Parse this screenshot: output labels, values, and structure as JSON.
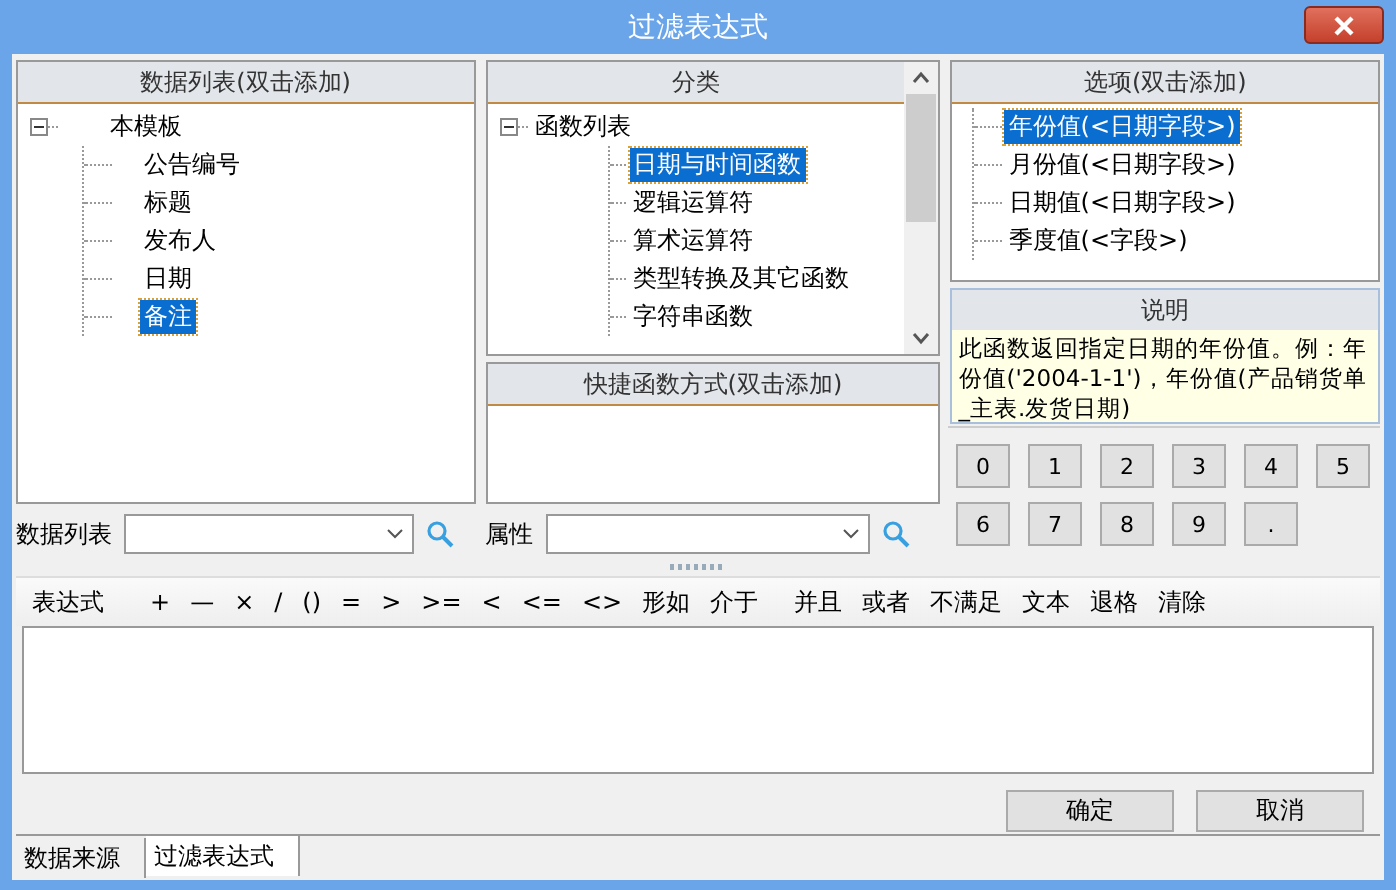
{
  "window": {
    "title": "过滤表达式"
  },
  "data_list": {
    "title": "数据列表(双击添加)",
    "tree": [
      {
        "label": "本模板",
        "expanded": true,
        "selected": false,
        "children": [
          {
            "label": "公告编号",
            "selected": false
          },
          {
            "label": "标题",
            "selected": false
          },
          {
            "label": "发布人",
            "selected": false
          },
          {
            "label": "日期",
            "selected": false
          },
          {
            "label": "备注",
            "selected": true
          }
        ]
      }
    ]
  },
  "data_list_filter": {
    "label": "数据列表"
  },
  "category": {
    "title": "分类",
    "tree": [
      {
        "label": "函数列表",
        "expanded": true,
        "selected": false,
        "children": [
          {
            "label": "日期与时间函数",
            "selected": true
          },
          {
            "label": "逻辑运算符",
            "selected": false
          },
          {
            "label": "算术运算符",
            "selected": false
          },
          {
            "label": "类型转换及其它函数",
            "selected": false
          },
          {
            "label": "字符串函数",
            "selected": false
          }
        ]
      }
    ]
  },
  "shortcut": {
    "title": "快捷函数方式(双击添加)"
  },
  "property_filter": {
    "label": "属性"
  },
  "options": {
    "title": "选项(双击添加)",
    "items": [
      {
        "label": "年份值(<日期字段>)",
        "selected": true
      },
      {
        "label": "月份值(<日期字段>)",
        "selected": false
      },
      {
        "label": "日期值(<日期字段>)",
        "selected": false
      },
      {
        "label": "季度值(<字段>)",
        "selected": false
      }
    ]
  },
  "description": {
    "title": "说明",
    "text": "此函数返回指定日期的年份值。例：年份值('2004-1-1')，年份值(产品销货单_主表.发货日期)"
  },
  "keypad": [
    "0",
    "1",
    "2",
    "3",
    "4",
    "5",
    "6",
    "7",
    "8",
    "9",
    "."
  ],
  "toolbar": [
    {
      "kind": "label",
      "text": "表达式"
    },
    {
      "kind": "button",
      "text": "+"
    },
    {
      "kind": "button",
      "text": "—"
    },
    {
      "kind": "button",
      "text": "×"
    },
    {
      "kind": "button",
      "text": "/"
    },
    {
      "kind": "button",
      "text": "()"
    },
    {
      "kind": "button",
      "text": "="
    },
    {
      "kind": "button",
      "text": ">"
    },
    {
      "kind": "button",
      "text": ">="
    },
    {
      "kind": "button",
      "text": "<"
    },
    {
      "kind": "button",
      "text": "<="
    },
    {
      "kind": "button",
      "text": "<>"
    },
    {
      "kind": "button",
      "text": "形如"
    },
    {
      "kind": "button",
      "text": "介于"
    },
    {
      "kind": "button",
      "text": "并且"
    },
    {
      "kind": "button",
      "text": "或者"
    },
    {
      "kind": "button",
      "text": "不满足"
    },
    {
      "kind": "button",
      "text": "文本"
    },
    {
      "kind": "button",
      "text": "退格"
    },
    {
      "kind": "button",
      "text": "清除"
    }
  ],
  "buttons": [
    "确定",
    "取消"
  ],
  "tabs": [
    {
      "label": "数据来源",
      "selected": false
    },
    {
      "label": "过滤表达式",
      "selected": true
    }
  ]
}
